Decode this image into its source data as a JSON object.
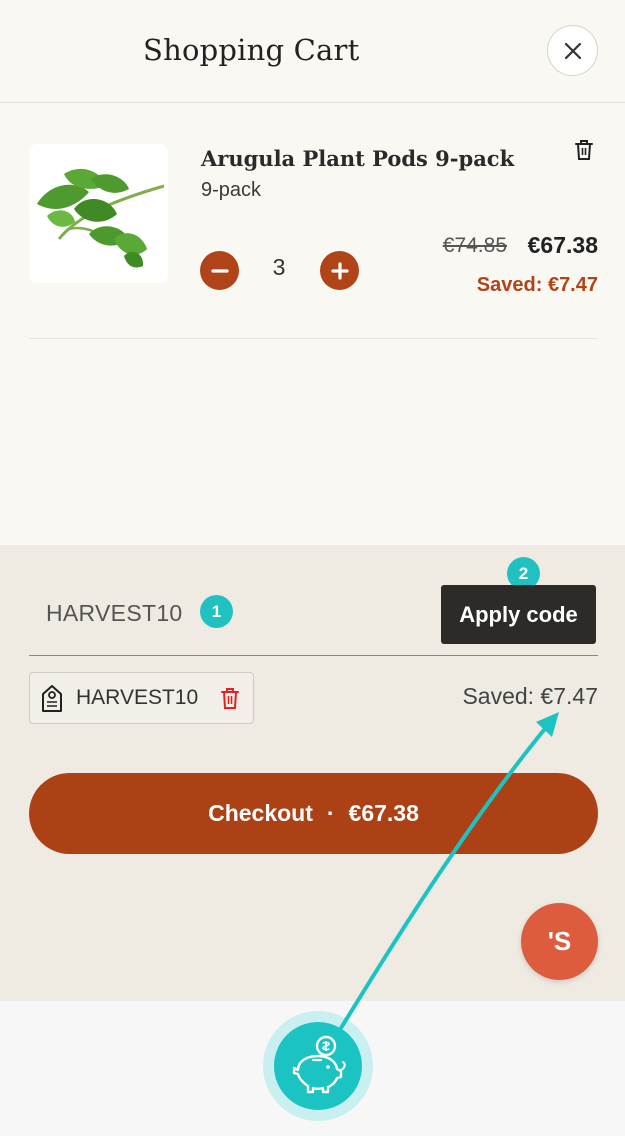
{
  "header": {
    "title": "Shopping Cart"
  },
  "cart": {
    "item": {
      "name": "Arugula Plant Pods 9-pack",
      "variant": "9-pack",
      "quantity": "3",
      "price_original": "€74.85",
      "price_current": "€67.38",
      "saved": "Saved: €7.47"
    }
  },
  "promo": {
    "input_value": "HARVEST10",
    "apply_label": "Apply code",
    "applied_code": "HARVEST10",
    "saved_total": "Saved: €7.47"
  },
  "checkout": {
    "label": "Checkout",
    "separator": "·",
    "total": "€67.38"
  },
  "annotations": {
    "step1": "1",
    "step2": "2"
  },
  "chat": {
    "glyph": "'S"
  },
  "icons": {
    "close": "close-icon",
    "trash": "trash-icon",
    "minus": "minus-icon",
    "plus": "plus-icon",
    "tag": "tag-icon",
    "piggy": "piggy-bank-icon"
  },
  "colors": {
    "accent": "#b04418",
    "checkout": "#ad4116",
    "apply_button": "#2d2b28",
    "annotation": "#21c1c2",
    "chat_fab": "#dd5c3e"
  }
}
